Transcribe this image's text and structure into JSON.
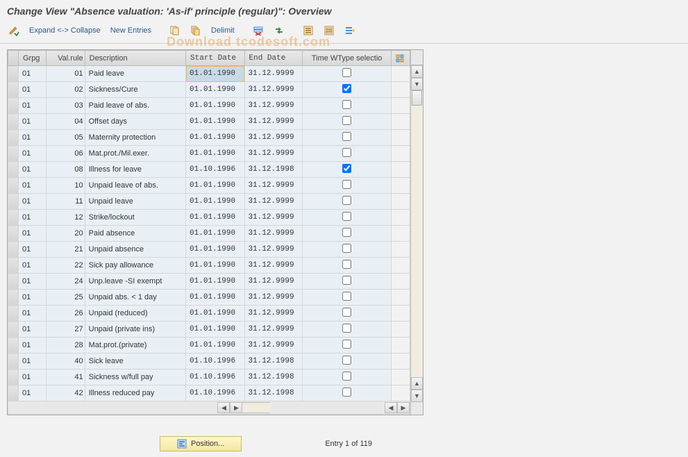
{
  "title": "Change View \"Absence valuation: 'As-if' principle (regular)\": Overview",
  "toolbar": {
    "expand_collapse": "Expand <-> Collapse",
    "new_entries": "New Entries",
    "delimit": "Delimit"
  },
  "columns": {
    "grpg": "Grpg",
    "valrule": "Val.rule",
    "description": "Description",
    "start": "Start Date",
    "end": "End Date",
    "check": "Time WType selectio"
  },
  "rows": [
    {
      "grpg": "01",
      "valrule": "01",
      "desc": "Paid leave",
      "start": "01.01.1990",
      "end": "31.12.9999",
      "chk": false,
      "selected": true
    },
    {
      "grpg": "01",
      "valrule": "02",
      "desc": "Sickness/Cure",
      "start": "01.01.1990",
      "end": "31.12.9999",
      "chk": true
    },
    {
      "grpg": "01",
      "valrule": "03",
      "desc": "Paid leave of abs.",
      "start": "01.01.1990",
      "end": "31.12.9999",
      "chk": false
    },
    {
      "grpg": "01",
      "valrule": "04",
      "desc": "Offset days",
      "start": "01.01.1990",
      "end": "31.12.9999",
      "chk": false
    },
    {
      "grpg": "01",
      "valrule": "05",
      "desc": "Maternity protection",
      "start": "01.01.1990",
      "end": "31.12.9999",
      "chk": false
    },
    {
      "grpg": "01",
      "valrule": "06",
      "desc": "Mat.prot./Mil.exer.",
      "start": "01.01.1990",
      "end": "31.12.9999",
      "chk": false
    },
    {
      "grpg": "01",
      "valrule": "08",
      "desc": "Illness for leave",
      "start": "01.10.1996",
      "end": "31.12.1998",
      "chk": true
    },
    {
      "grpg": "01",
      "valrule": "10",
      "desc": "Unpaid leave of abs.",
      "start": "01.01.1990",
      "end": "31.12.9999",
      "chk": false
    },
    {
      "grpg": "01",
      "valrule": "11",
      "desc": "Unpaid leave",
      "start": "01.01.1990",
      "end": "31.12.9999",
      "chk": false
    },
    {
      "grpg": "01",
      "valrule": "12",
      "desc": "Strike/lockout",
      "start": "01.01.1990",
      "end": "31.12.9999",
      "chk": false
    },
    {
      "grpg": "01",
      "valrule": "20",
      "desc": "Paid absence",
      "start": "01.01.1990",
      "end": "31.12.9999",
      "chk": false
    },
    {
      "grpg": "01",
      "valrule": "21",
      "desc": "Unpaid absence",
      "start": "01.01.1990",
      "end": "31.12.9999",
      "chk": false
    },
    {
      "grpg": "01",
      "valrule": "22",
      "desc": "Sick pay allowance",
      "start": "01.01.1990",
      "end": "31.12.9999",
      "chk": false
    },
    {
      "grpg": "01",
      "valrule": "24",
      "desc": "Unp.leave -SI exempt",
      "start": "01.01.1990",
      "end": "31.12.9999",
      "chk": false
    },
    {
      "grpg": "01",
      "valrule": "25",
      "desc": "Unpaid abs. < 1 day",
      "start": "01.01.1990",
      "end": "31.12.9999",
      "chk": false
    },
    {
      "grpg": "01",
      "valrule": "26",
      "desc": "Unpaid (reduced)",
      "start": "01.01.1990",
      "end": "31.12.9999",
      "chk": false
    },
    {
      "grpg": "01",
      "valrule": "27",
      "desc": "Unpaid (private ins)",
      "start": "01.01.1990",
      "end": "31.12.9999",
      "chk": false
    },
    {
      "grpg": "01",
      "valrule": "28",
      "desc": "Mat.prot.(private)",
      "start": "01.01.1990",
      "end": "31.12.9999",
      "chk": false
    },
    {
      "grpg": "01",
      "valrule": "40",
      "desc": "Sick leave",
      "start": "01.10.1996",
      "end": "31.12.1998",
      "chk": false
    },
    {
      "grpg": "01",
      "valrule": "41",
      "desc": "Sickness w/full pay",
      "start": "01.10.1996",
      "end": "31.12.1998",
      "chk": false
    },
    {
      "grpg": "01",
      "valrule": "42",
      "desc": "Illness reduced pay",
      "start": "01.10.1996",
      "end": "31.12.1998",
      "chk": false
    }
  ],
  "footer": {
    "position": "Position...",
    "entry": "Entry 1 of 119"
  },
  "watermark": "Download tcodesoft.com"
}
